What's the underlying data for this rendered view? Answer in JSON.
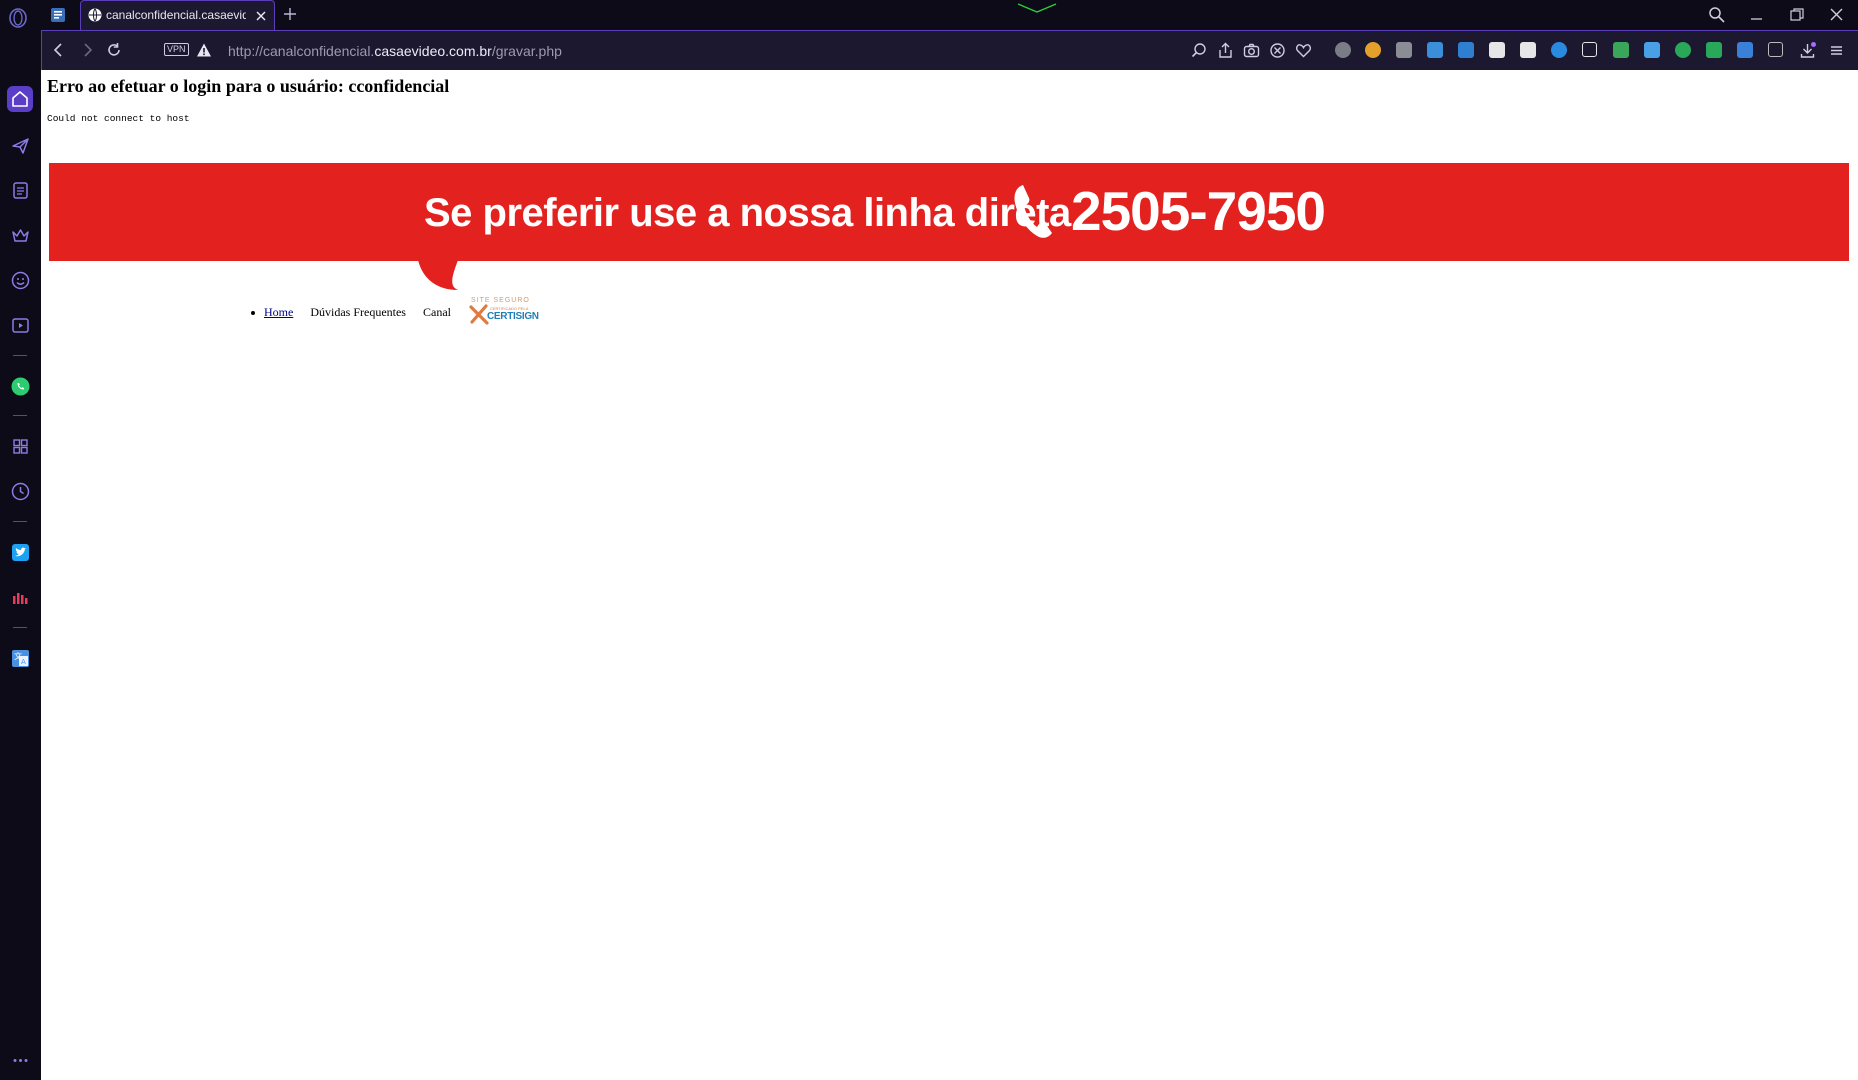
{
  "browser": {
    "tab": {
      "title": "canalconfidencial.casaevideo.com.br"
    },
    "address": {
      "vpn_label": "VPN",
      "url_prefix": "http://canalconfidencial.",
      "url_host": "casaevideo.com.br",
      "url_path": "/gravar.php"
    },
    "icons": {
      "tabstrip": [
        "opera-logo-icon",
        "workspace-icon",
        "globe-icon",
        "close-icon",
        "plus-icon",
        "search-icon",
        "minimize-icon",
        "maximize-icon",
        "window-close-icon"
      ],
      "toolbar": [
        "back-icon",
        "forward-icon",
        "reload-icon",
        "warning-icon",
        "search-icon",
        "share-icon",
        "camera-icon",
        "adblock-icon",
        "heart-icon",
        "download-icon",
        "menu-icon"
      ],
      "sidebar": [
        "home-icon",
        "flight-icon",
        "notes-icon",
        "crown-icon",
        "smiley-icon",
        "video-player-icon",
        "whatsapp-icon",
        "apps-icon",
        "history-icon",
        "twitter-icon",
        "stats-icon",
        "translate-icon",
        "more-icon"
      ]
    },
    "colors": {
      "accent": "#5a3ec8",
      "chrome_bg": "#0d0b17",
      "toolbar_bg": "#1b1830",
      "extension_colors": [
        "#7a7d86",
        "#e3a02b",
        "#8a8d96",
        "#3a8fd8",
        "#2f7fd1",
        "#e6e6e6",
        "#e6e6e6",
        "#2a8ae0",
        "#e6e6e6",
        "#3aa65a",
        "#4aa0e6",
        "#2aa85a",
        "#3a7fd8",
        "#bbbbbb"
      ]
    }
  },
  "page": {
    "error_heading": "Erro ao efetuar o login para o usuário: cconfidencial",
    "error_detail": "Could not connect to host",
    "banner": {
      "text": "Se preferir use a nossa linha direta",
      "phone": "2505-7950",
      "color": "#e3211f"
    },
    "menu": {
      "home": "Home",
      "faq": "Dúvidas Frequentes",
      "canal": "Canal"
    },
    "seal": {
      "top": "SITE SEGURO",
      "small": "CERTIFICADO PELA",
      "brand": "CERTISIGN"
    }
  }
}
